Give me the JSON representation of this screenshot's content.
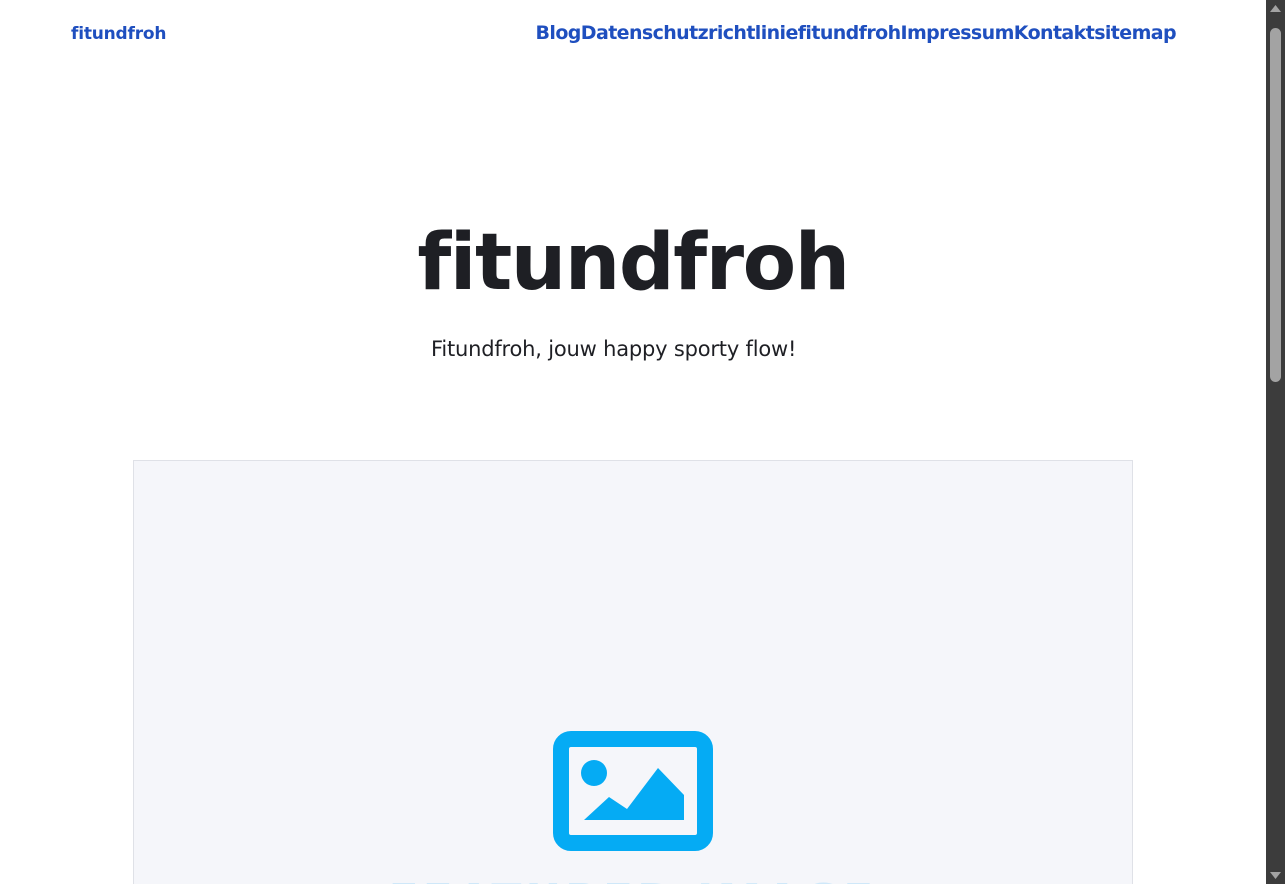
{
  "header": {
    "logo": "fitundfroh",
    "nav": [
      "Blog",
      "Datenschutzrichtlinie",
      "fitundfroh",
      "Impressum",
      "Kontakt",
      "sitemap"
    ]
  },
  "hero": {
    "title": "fitundfroh",
    "tagline": "Fitundfroh, jouw happy sporty flow!"
  },
  "featured": {
    "icon": "image-placeholder-icon",
    "caption": "FEATURED IMAGE"
  },
  "scrollbar": {
    "position_fraction": 0.0
  },
  "colors": {
    "link": "#1f4fbf",
    "text": "#1e1f24",
    "placeholder_bg": "#f5f6fa",
    "placeholder_icon": "#05abf4",
    "scrollbar_track": "#3c3c3c",
    "scrollbar_thumb": "#a3a3a3"
  }
}
